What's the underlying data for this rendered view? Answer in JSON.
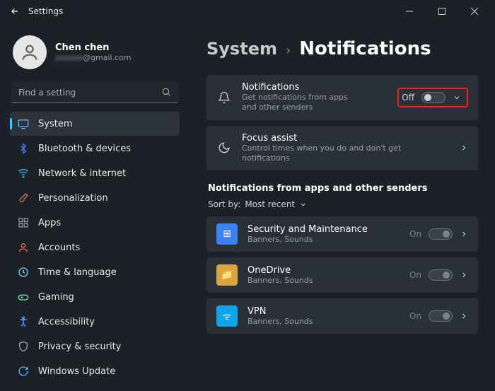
{
  "window": {
    "title": "Settings"
  },
  "profile": {
    "name": "Chen chen",
    "email_suffix": "@gmail.com"
  },
  "search": {
    "placeholder": "Find a setting"
  },
  "nav": [
    {
      "label": "System",
      "icon": "display",
      "color": "#4cc2ff",
      "active": true
    },
    {
      "label": "Bluetooth & devices",
      "icon": "bluetooth",
      "color": "#3b82f6"
    },
    {
      "label": "Network & internet",
      "icon": "wifi",
      "color": "#22c3e6"
    },
    {
      "label": "Personalization",
      "icon": "brush",
      "color": "#d97757"
    },
    {
      "label": "Apps",
      "icon": "apps",
      "color": "#8b9aa7"
    },
    {
      "label": "Accounts",
      "icon": "person",
      "color": "#e07a5f"
    },
    {
      "label": "Time & language",
      "icon": "clock",
      "color": "#7dd3fc"
    },
    {
      "label": "Gaming",
      "icon": "gamepad",
      "color": "#6ee7b7"
    },
    {
      "label": "Accessibility",
      "icon": "accessibility",
      "color": "#60a5fa"
    },
    {
      "label": "Privacy & security",
      "icon": "shield",
      "color": "#9aa0a6"
    },
    {
      "label": "Windows Update",
      "icon": "update",
      "color": "#38bdf8"
    }
  ],
  "breadcrumb": {
    "parent": "System",
    "current": "Notifications"
  },
  "cards": {
    "notifications": {
      "title": "Notifications",
      "sub": "Get notifications from apps and other senders",
      "state": "Off"
    },
    "focus": {
      "title": "Focus assist",
      "sub": "Control times when you do and don't get notifications"
    }
  },
  "section_header": "Notifications from apps and other senders",
  "sort": {
    "label": "Sort by:",
    "value": "Most recent"
  },
  "apps": [
    {
      "title": "Security and Maintenance",
      "sub": "Banners, Sounds",
      "state": "On",
      "bg": "#3b82f6",
      "glyph": "⊞"
    },
    {
      "title": "OneDrive",
      "sub": "Banners, Sounds",
      "state": "On",
      "bg": "#d9a441",
      "glyph": "📁"
    },
    {
      "title": "VPN",
      "sub": "Banners, Sounds",
      "state": "On",
      "bg": "#0ea5e9",
      "glyph": "ᯤ"
    }
  ]
}
